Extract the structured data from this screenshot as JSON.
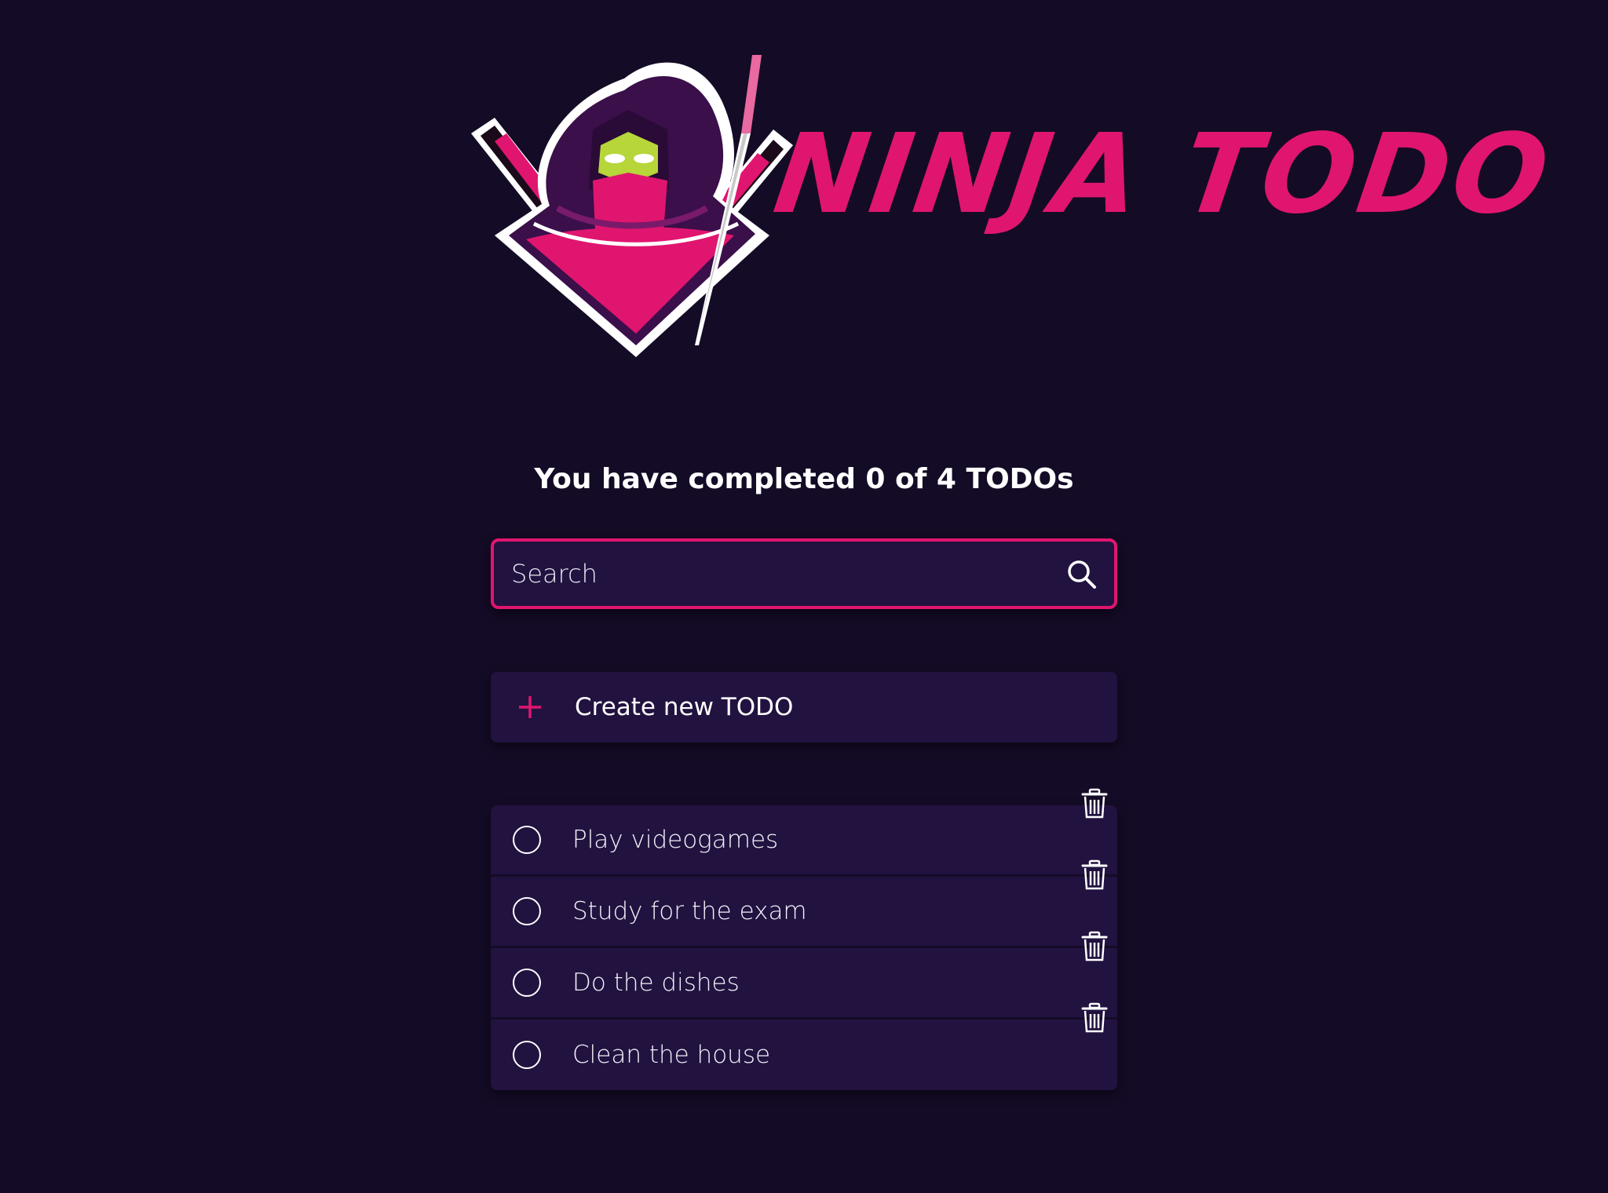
{
  "logo": {
    "text": "NINJA TODO",
    "colors": {
      "primary": "#e0156f",
      "mask": "#b6d63a",
      "hood": "#3a0f4a"
    }
  },
  "counter": {
    "text": "You have completed 0 of 4 TODOs"
  },
  "search": {
    "placeholder": "Search",
    "value": "",
    "icon": "search-icon"
  },
  "create": {
    "label": "Create new TODO",
    "icon": "plus-icon"
  },
  "todos": [
    {
      "text": "Play videogames",
      "completed": false
    },
    {
      "text": "Study for the exam",
      "completed": false
    },
    {
      "text": "Do the dishes",
      "completed": false
    },
    {
      "text": "Clean the house",
      "completed": false
    }
  ],
  "colors": {
    "background": "#140b26",
    "card": "#221240",
    "accent": "#e0156f",
    "text": "#ffffff"
  }
}
